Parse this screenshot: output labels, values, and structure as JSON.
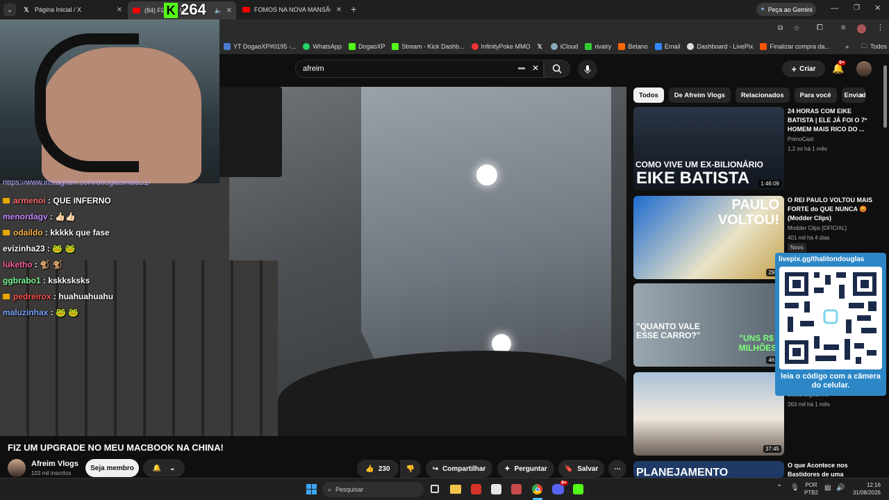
{
  "browser": {
    "tabs": [
      {
        "label": "Página Inicial / X",
        "icon": "x-logo-icon"
      },
      {
        "label": "(84) FIZ UM UPGRADE NO",
        "icon": "youtube-icon"
      },
      {
        "label": "FOMOS NA NOVA MANSÃO D",
        "icon": "youtube-icon"
      }
    ],
    "gemini_button": "Peça ao Gemini",
    "bookmarks": [
      "YT DogaoXP#0195 -...",
      "WhatsApp",
      "DogaoXP",
      "Stream - Kick Dashb...",
      "InfinityPoke MMO",
      "iCloud",
      "rivalry",
      "Betano",
      "Email",
      "Dashboard - LivePix",
      "Finalizar compra da..."
    ],
    "bookmarks_more": "»",
    "all_favorites": "Todos os favoritos"
  },
  "overlay": {
    "viewer_count": "264",
    "instagram_url": "https://www.instagram.com/douglasmaia31/"
  },
  "chat": [
    {
      "user": "armenoi",
      "msg": "QUE INFERNO",
      "color": "#ff6b6b",
      "badge": true
    },
    {
      "user": "menordagv",
      "msg": "👍🏻👍🏻",
      "color": "#c48cff",
      "badge": false
    },
    {
      "user": "odaildo",
      "msg": "kkkkk que fase",
      "color": "#ffb347",
      "badge": true
    },
    {
      "user": "evizinha23",
      "msg": "🐸 🐸",
      "color": "#ffffff",
      "badge": false
    },
    {
      "user": "luketho",
      "msg": "🐒 🐒",
      "color": "#ff5fa2",
      "badge": false
    },
    {
      "user": "ggbrabo1",
      "msg": "kskksksks",
      "color": "#7cff9a",
      "badge": false
    },
    {
      "user": "pedreirox",
      "msg": "huahuahuahu",
      "color": "#ff5252",
      "badge": true
    },
    {
      "user": "maluzinhax",
      "msg": "🐸 🐸",
      "color": "#7aa6ff",
      "badge": false
    }
  ],
  "youtube": {
    "search_value": "afreim",
    "create_label": "Criar",
    "notif_count": "9+",
    "video_title": "FIZ UM UPGRADE NO MEU MACBOOK NA CHINA!",
    "channel": "Afreim Vlogs",
    "subscribers": "103 mil inscritos",
    "member_button": "Seja membro",
    "likes": "230",
    "share": "Compartilhar",
    "ask": "Perguntar",
    "save": "Salvar",
    "chips": [
      "Todos",
      "De Afreim Vlogs",
      "Relacionados",
      "Para você",
      "Enviad"
    ],
    "recs": [
      {
        "title": "24 HORAS COM EIKE BATISTA | ELE JÁ FOI O 7º HOMEM MAIS RICO DO ...",
        "channel": "PrimoCast",
        "meta": "1,2 mi  há 1 mês",
        "duration": "1:46:09",
        "thumb_text": "EIKE BATISTA",
        "thumb_sub": "COMO VIVE UM EX-BILIONÁRIO"
      },
      {
        "title": "O REI PAULO VOLTOU MAIS FORTE do QUE NUNCA 😡 (Modder Clips)",
        "channel": "Modder Clips [OFICIAL]",
        "meta": "401 mil  há 4 dias",
        "badge": "Novo",
        "duration": "29:4",
        "thumb_text": "PAULO VOLTOU!"
      },
      {
        "title": "",
        "channel": "",
        "meta": "",
        "duration": "46:0",
        "thumb_text": "\"QUANTO VALE ESSE CARRO?\"",
        "thumb_sub": "\"UNS R$ 4 MILHÕES\""
      },
      {
        "title": "",
        "channel": "Lucas Bigodinho",
        "meta": "263 mil  há 1 mês",
        "duration": "37:45"
      },
      {
        "title": "O que Acontece nos Bastidores de uma",
        "channel": "",
        "meta": "",
        "thumb_text": "PLANEJAMENTO"
      }
    ]
  },
  "livepix": {
    "handle": "livepix.gg/thalitondouglas",
    "caption": "leia o código com a câmera do celular."
  },
  "taskbar": {
    "search_placeholder": "Pesquisar",
    "lang1": "POR",
    "lang2": "PTB2",
    "time": "12:16",
    "date": "31/08/2026",
    "discord_badge": "9+"
  }
}
